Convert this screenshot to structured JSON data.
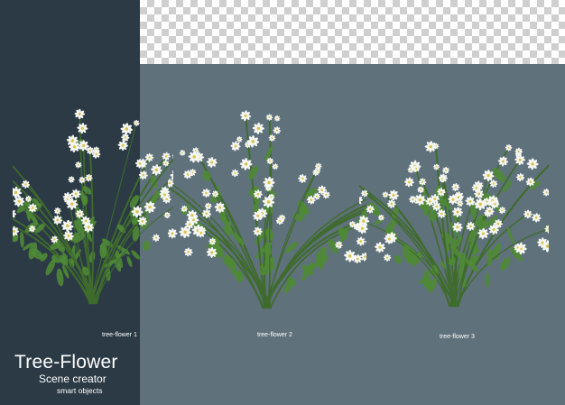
{
  "scene": {
    "colors": {
      "left_panel": "#2b3a45",
      "stage": "#5f717b",
      "stem": "#3f6b2d",
      "leaf": "#4f8a35",
      "petal": "#f4f6f2",
      "center": "#d9c24a"
    }
  },
  "plants": [
    {
      "label": "tree-flower 1"
    },
    {
      "label": "tree-flower 2"
    },
    {
      "label": "tree-flower 3"
    }
  ],
  "branding": {
    "title": "Tree-Flower",
    "subtitle": "Scene creator",
    "tagline": "smart objects"
  }
}
